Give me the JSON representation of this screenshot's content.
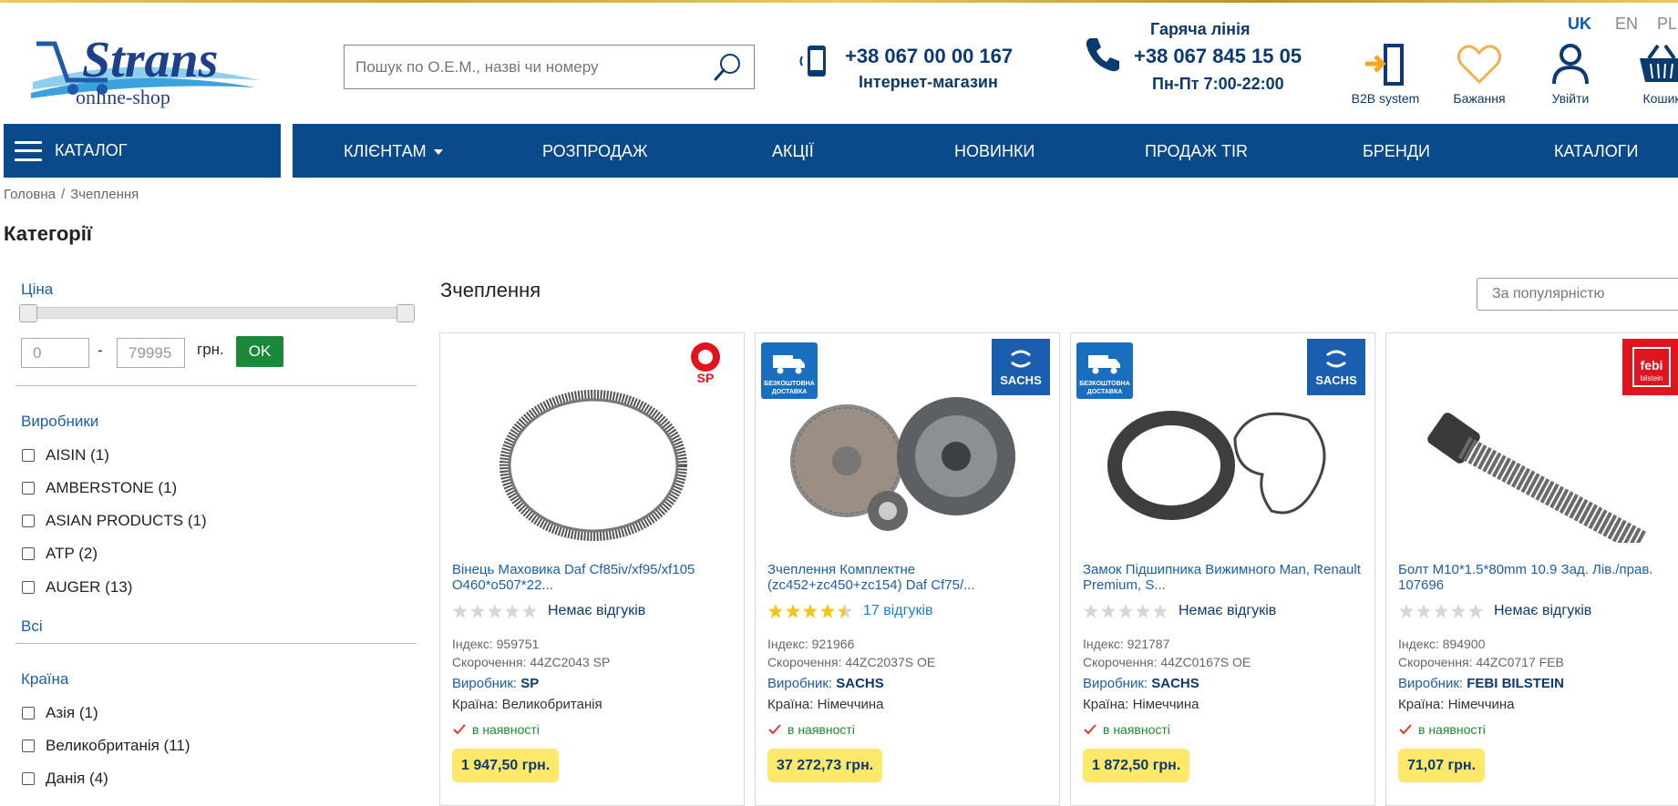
{
  "header": {
    "logo_text": "Strans",
    "logo_sub": "online-shop",
    "search_placeholder": "Пошук по О.Е.М., назві чи номеру",
    "phone1": {
      "number": "+38 067 00 00 167",
      "label": "Інтернет-магазин"
    },
    "phone2": {
      "title": "Гаряча лінія",
      "number": "+38 067 845 15 05",
      "hours": "Пн-Пт 7:00-22:00"
    },
    "languages": [
      "UK",
      "EN",
      "PL"
    ],
    "icons": [
      {
        "icon": "door-enter-icon",
        "label": "B2B system"
      },
      {
        "icon": "heart-icon",
        "label": "Бажання"
      },
      {
        "icon": "user-icon",
        "label": "Увійти"
      },
      {
        "icon": "basket-icon",
        "label": "Кошик"
      }
    ]
  },
  "nav": {
    "catalog": "КАТАЛОГ",
    "items": [
      "КЛІЄНТАМ",
      "РОЗПРОДАЖ",
      "АКЦІЇ",
      "НОВИНКИ",
      "ПРОДАЖ TIR",
      "БРЕНДИ",
      "КАТАЛОГИ"
    ]
  },
  "breadcrumbs": [
    "Головна",
    "/",
    "Зчеплення"
  ],
  "sidebar": {
    "title": "Категорії",
    "price": {
      "title": "Ціна",
      "min": "0",
      "max": "79995",
      "currency": "грн.",
      "ok": "OK",
      "dash": "-"
    },
    "manufacturers": {
      "title": "Виробники",
      "items": [
        "AISIN (1)",
        "AMBERSTONE (1)",
        "ASIAN PRODUCTS (1)",
        "ATP (2)",
        "AUGER (13)"
      ],
      "all": "Всі"
    },
    "country": {
      "title": "Країна",
      "items": [
        "Азія (1)",
        "Великобританія (11)",
        "Данія (4)"
      ]
    }
  },
  "main": {
    "title": "Зчеплення",
    "sort": "За популярністю",
    "labels": {
      "index": "Індекс: ",
      "short": "Скорочення: ",
      "maker": "Виробник: ",
      "country": "Країна: ",
      "stock": "в наявності",
      "free_delivery": "БЕЗКОШТОВНА ДОСТАВКА"
    },
    "products": [
      {
        "name": "Вінець Маховика Daf Cf85iv/xf95/xf105 O460*o507*22...",
        "rating": 0,
        "reviews": "Немає відгуків",
        "index": "959751",
        "short": "44ZC2043 SP",
        "maker": "SP",
        "country": "Великобританія",
        "price": "1 947,50 грн.",
        "free_delivery": false,
        "brand": "SP"
      },
      {
        "name": "Зчеплення Комплектне (zc452+zc450+zc154) Daf Cf75/...",
        "rating": 4.5,
        "reviews": "17 відгуків",
        "index": "921966",
        "short": "44ZC2037S OE",
        "maker": "SACHS",
        "country": "Німеччина",
        "price": "37 272,73 грн.",
        "free_delivery": true,
        "brand": "SACHS"
      },
      {
        "name": "Замок Підшипника Вижимного Man, Renault Premium, S...",
        "rating": 0,
        "reviews": "Немає відгуків",
        "index": "921787",
        "short": "44ZC0167S OE",
        "maker": "SACHS",
        "country": "Німеччина",
        "price": "1 872,50 грн.",
        "free_delivery": true,
        "brand": "SACHS"
      },
      {
        "name": "Болт М10*1.5*80mm 10.9 Зад. Лів./прав. 107696",
        "rating": 0,
        "reviews": "Немає відгуків",
        "index": "894900",
        "short": "44ZC0717 FEB",
        "maker": "FEBI BILSTEIN",
        "country": "Німеччина",
        "price": "71,07 грн.",
        "free_delivery": false,
        "brand": "febi bilstein"
      }
    ]
  }
}
